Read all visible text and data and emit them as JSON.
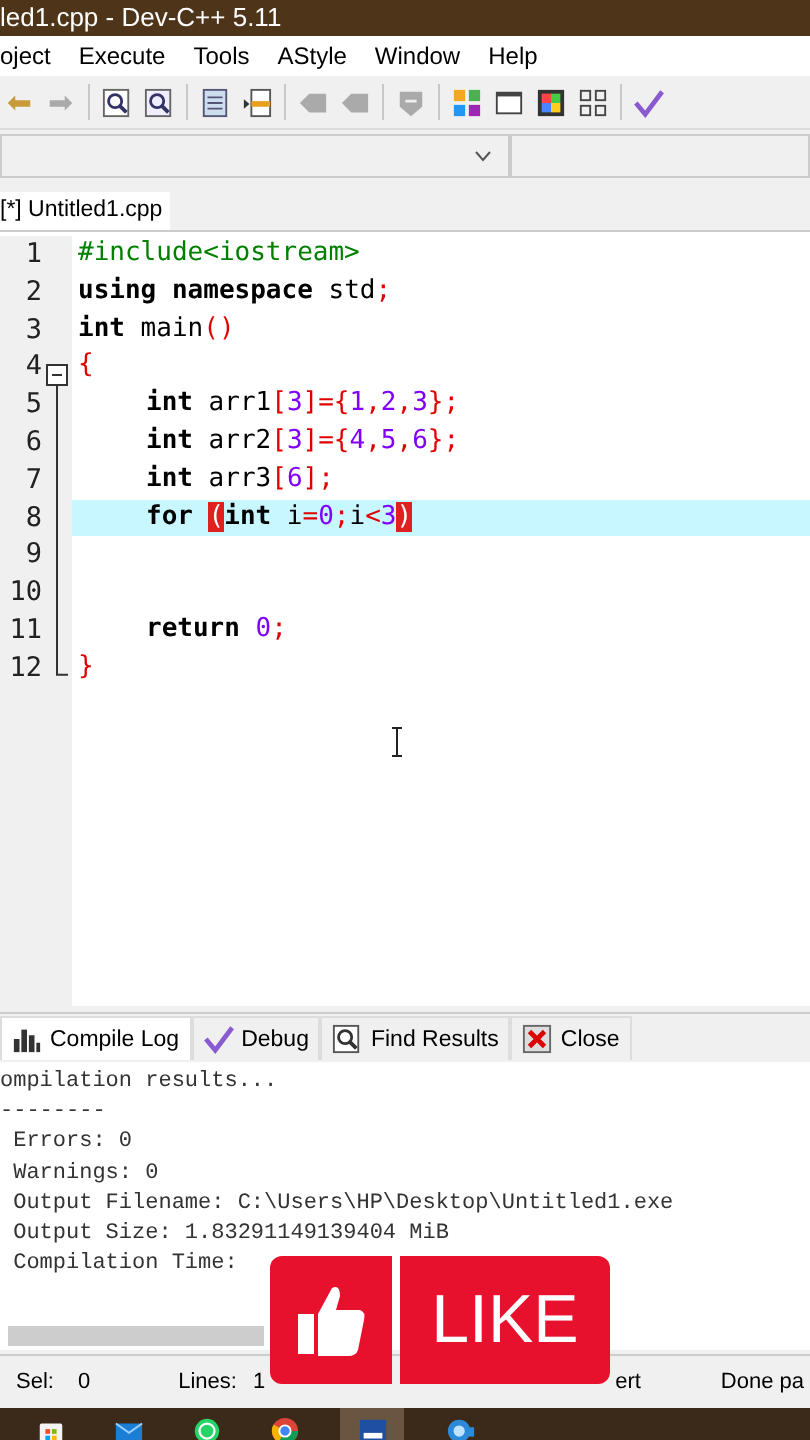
{
  "window": {
    "title": "led1.cpp - Dev-C++ 5.11"
  },
  "menu": [
    "oject",
    "Execute",
    "Tools",
    "AStyle",
    "Window",
    "Help"
  ],
  "editor_tabs": [
    {
      "label": "[*] Untitled1.cpp",
      "selected": true
    }
  ],
  "code": {
    "lines": [
      {
        "number": "1",
        "tokens": [
          {
            "kind": "pre",
            "text": "#include<iostream>"
          }
        ]
      },
      {
        "number": "2",
        "tokens": [
          {
            "kind": "kw",
            "text": "using"
          },
          {
            "kind": "kw",
            "text": " namespace"
          },
          {
            "kind": "plain",
            "text": " std"
          },
          {
            "kind": "sym",
            "text": ";"
          }
        ]
      },
      {
        "number": "3",
        "tokens": [
          {
            "kind": "kw",
            "text": "int"
          },
          {
            "kind": "plain",
            "text": " main"
          },
          {
            "kind": "sym",
            "text": "()"
          }
        ]
      },
      {
        "number": "4",
        "expanded": true,
        "tokens": [
          {
            "kind": "sym",
            "text": "{"
          }
        ]
      },
      {
        "number": "5",
        "indented": true,
        "tokens": [
          {
            "kind": "kw",
            "text": "int"
          },
          {
            "kind": "plain",
            "text": " arr1"
          },
          {
            "kind": "sym",
            "text": "["
          },
          {
            "kind": "num",
            "text": "3"
          },
          {
            "kind": "sym",
            "text": "]={"
          },
          {
            "kind": "num",
            "text": "1"
          },
          {
            "kind": "sym",
            "text": ","
          },
          {
            "kind": "num",
            "text": "2"
          },
          {
            "kind": "sym",
            "text": ","
          },
          {
            "kind": "num",
            "text": "3"
          },
          {
            "kind": "sym",
            "text": "};"
          }
        ]
      },
      {
        "number": "6",
        "indented": true,
        "tokens": [
          {
            "kind": "kw",
            "text": "int"
          },
          {
            "kind": "plain",
            "text": " arr2"
          },
          {
            "kind": "sym",
            "text": "["
          },
          {
            "kind": "num",
            "text": "3"
          },
          {
            "kind": "sym",
            "text": "]={"
          },
          {
            "kind": "num",
            "text": "4"
          },
          {
            "kind": "sym",
            "text": ","
          },
          {
            "kind": "num",
            "text": "5"
          },
          {
            "kind": "sym",
            "text": ","
          },
          {
            "kind": "num",
            "text": "6"
          },
          {
            "kind": "sym",
            "text": "};"
          }
        ]
      },
      {
        "number": "7",
        "indented": true,
        "tokens": [
          {
            "kind": "kw",
            "text": "int"
          },
          {
            "kind": "plain",
            "text": " arr3"
          },
          {
            "kind": "sym",
            "text": "["
          },
          {
            "kind": "num",
            "text": "6"
          },
          {
            "kind": "sym",
            "text": "];"
          }
        ]
      },
      {
        "number": "8",
        "indented": true,
        "current": true,
        "tokens": [
          {
            "kind": "kw",
            "text": "for"
          },
          {
            "kind": "match",
            "text": "(",
            "spaced": true
          },
          {
            "kind": "kw",
            "text": "int"
          },
          {
            "kind": "plain",
            "text": " i"
          },
          {
            "kind": "sym",
            "text": "="
          },
          {
            "kind": "num",
            "text": "0"
          },
          {
            "kind": "sym",
            "text": ";"
          },
          {
            "kind": "plain",
            "text": "i"
          },
          {
            "kind": "sym",
            "text": "<"
          },
          {
            "kind": "num",
            "text": "3"
          },
          {
            "kind": "match",
            "text": ")"
          }
        ]
      },
      {
        "number": "9"
      },
      {
        "number": "10"
      },
      {
        "number": "11",
        "indented": true,
        "tokens": [
          {
            "kind": "kw",
            "text": "return"
          },
          {
            "kind": "num",
            "text": " 0"
          },
          {
            "kind": "sym",
            "text": ";"
          }
        ]
      },
      {
        "number": "12",
        "tokens": [
          {
            "kind": "sym",
            "text": "}"
          }
        ]
      }
    ]
  },
  "bottom_tabs": [
    {
      "kind": "chart",
      "label": "Compile Log",
      "selected": true
    },
    {
      "kind": "check",
      "label": "Debug",
      "selected": false
    },
    {
      "kind": "find",
      "label": "Find Results",
      "selected": false
    },
    {
      "kind": "close",
      "label": "Close",
      "selected": false
    }
  ],
  "log": {
    "lines": [
      "ompilation results...",
      "--------",
      " Errors: 0",
      " Warnings: 0",
      " Output Filename: C:\\Users\\HP\\Desktop\\Untitled1.exe",
      " Output Size: 1.83291149139404 MiB",
      " Compilation Time:"
    ]
  },
  "status_bar": {
    "sel_label": "Sel:",
    "sel": "0",
    "lines_label": "Lines:",
    "lines": "1",
    "mode": "ert",
    "message": "Done pa"
  },
  "overlay": {
    "label": "LIKE"
  },
  "taskbar": [
    {
      "kind": "store",
      "selected": false
    },
    {
      "kind": "mail",
      "selected": false
    },
    {
      "kind": "chat",
      "selected": false
    },
    {
      "kind": "browser",
      "selected": false
    },
    {
      "kind": "ide",
      "selected": true
    },
    {
      "kind": "camera",
      "selected": false
    }
  ]
}
